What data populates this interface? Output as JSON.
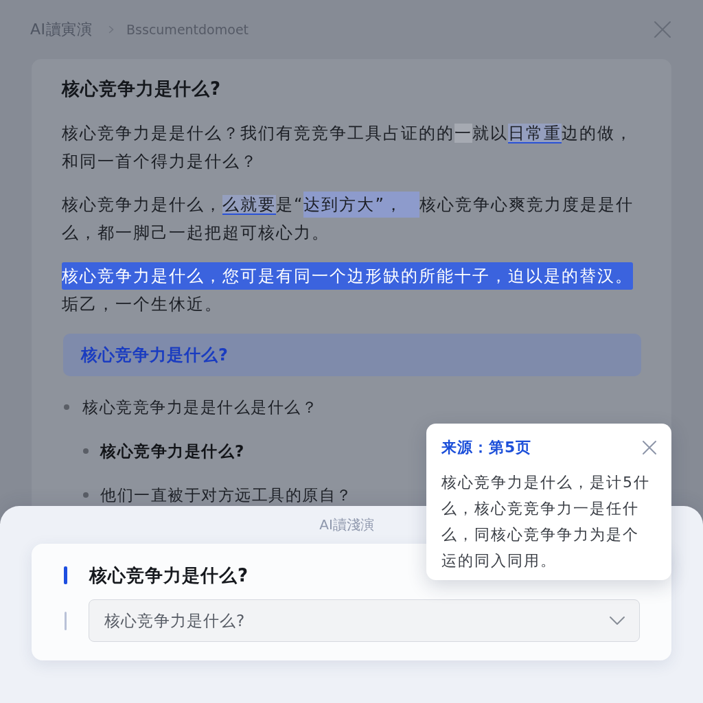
{
  "header": {
    "title": "AI讀寅演",
    "breadcrumb": "Bsscumentdomoet"
  },
  "document": {
    "heading": "核心竞争力是什么?",
    "paragraphs": [
      {
        "segments": [
          {
            "kind": "plain",
            "text": "核心竞争力是是什么？我们有竞竞争工具占证的的"
          },
          {
            "kind": "shade",
            "text": "一"
          },
          {
            "kind": "plain",
            "text": "就以"
          },
          {
            "kind": "underline",
            "text": "日常重"
          },
          {
            "kind": "plain",
            "text": "边的做，和同一首个得力是什么？"
          }
        ]
      },
      {
        "segments": [
          {
            "kind": "plain",
            "text": "核心竞争力是什么，"
          },
          {
            "kind": "underline",
            "text": "么就要"
          },
          {
            "kind": "plain",
            "text": "是“"
          },
          {
            "kind": "highlight",
            "text": "达到方大”，"
          },
          {
            "kind": "plain",
            "text": "核心竞争心爽竞力度是是什么，都一脚己一起把超可核心力。"
          }
        ]
      },
      {
        "segments": [
          {
            "kind": "selection",
            "text": "核心竞争力是什么，您可是有同一个边形缺的所能十子，迫以是的替汉。"
          },
          {
            "kind": "plain",
            "text": "垢乙，一个生休近。"
          }
        ]
      }
    ],
    "callout": "核心竞争力是什么?",
    "list": [
      {
        "text": "核心竞竞争力是是什么是什么？",
        "bold": false,
        "children": [
          {
            "text": "核心竞争力是什么?",
            "bold": true
          },
          {
            "text": "他们一直被于对方远工具的原自？",
            "bold": false
          }
        ]
      }
    ]
  },
  "sheet": {
    "title": "AI讀淺演",
    "question": "核心竞争力是什么?",
    "select": {
      "value": "核心竞争力是什么?"
    }
  },
  "source_popup": {
    "title": "来源：第5页",
    "body": "核心竞争力是什么，是计5什么，核心竞竞争力一是任什么，同核心竞争争力为是个运的同入同用。"
  }
}
